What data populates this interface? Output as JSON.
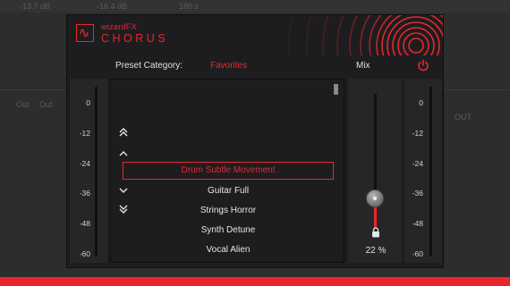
{
  "host": {
    "faint_texts": [
      "-13.7 dB",
      "-16.4 dB",
      "180 s",
      "Out",
      "Out",
      "OUT"
    ]
  },
  "plugin": {
    "brand_small": "wizardFX",
    "brand_name": "CHORUS",
    "accent_color": "#e8272c",
    "preset_category_label": "Preset Category:",
    "preset_category_value": "Favorites",
    "mix_label": "Mix",
    "power_icon": "power-icon",
    "input_meter_scale": [
      "0",
      "-12",
      "-24",
      "-36",
      "-48",
      "-60"
    ],
    "output_meter_scale": [
      "0",
      "-12",
      "-24",
      "-36",
      "-48",
      "-60"
    ],
    "presets": [
      {
        "label": "Drum Subtle Movement",
        "selected": true
      },
      {
        "label": "Guitar Full",
        "selected": false
      },
      {
        "label": "Strings Horror",
        "selected": false
      },
      {
        "label": "Synth Detune",
        "selected": false
      },
      {
        "label": "Vocal Alien",
        "selected": false
      }
    ],
    "mix_value_fraction": 0.22,
    "mix_percent_text": "22 %"
  }
}
